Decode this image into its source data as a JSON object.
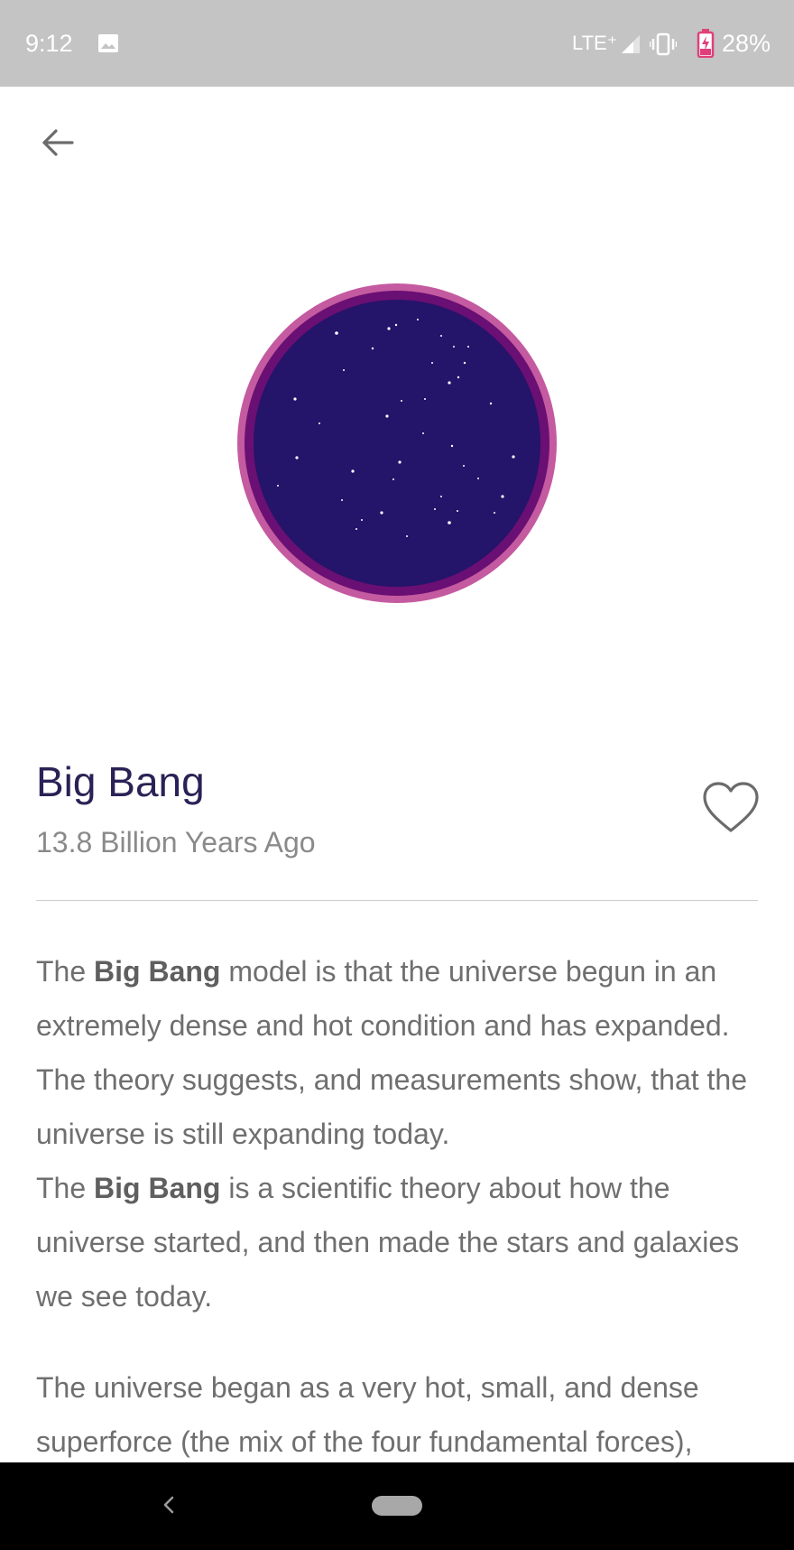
{
  "status_bar": {
    "time": "9:12",
    "network": "LTE⁺",
    "battery": "28%",
    "icons": [
      "image-icon",
      "signal-icon",
      "vibrate-icon",
      "battery-charging-icon"
    ]
  },
  "toolbar": {
    "back_icon": "arrow-left-icon"
  },
  "hero": {
    "description_icon": "big-bang-universe-circle",
    "colors": {
      "outer_ring": "#c45aa0",
      "inner_ring": "#6a0f73",
      "space": "#24146a",
      "stars": "#ffffff"
    }
  },
  "detail": {
    "title": "Big Bang",
    "subtitle": "13.8 Billion Years Ago",
    "favorite_icon": "heart-outline-icon",
    "paragraph1": {
      "s1_pre": "The ",
      "s1_bold": "Big Bang",
      "s1_post": " model is that the universe begun in an extremely dense and hot condition and has expanded. The theory suggests, and measurements show, that the universe is still expanding today.",
      "s2_pre": "The ",
      "s2_bold": "Big Bang",
      "s2_post": " is a scientific theory about how the universe started, and then made the stars and galaxies we see today."
    },
    "paragraph2": "The universe began as a very hot, small, and dense superforce (the mix of the four fundamental forces),"
  },
  "nav_bar": {
    "back_icon": "nav-back-chevron-icon",
    "home_icon": "nav-home-pill-icon"
  },
  "theme": {
    "title_color": "#2a2256",
    "subtitle_color": "#8a8a8a",
    "body_color": "#6f6f6f",
    "status_bar_color": "#c4c4c4",
    "battery_accent": "#e0407a"
  }
}
